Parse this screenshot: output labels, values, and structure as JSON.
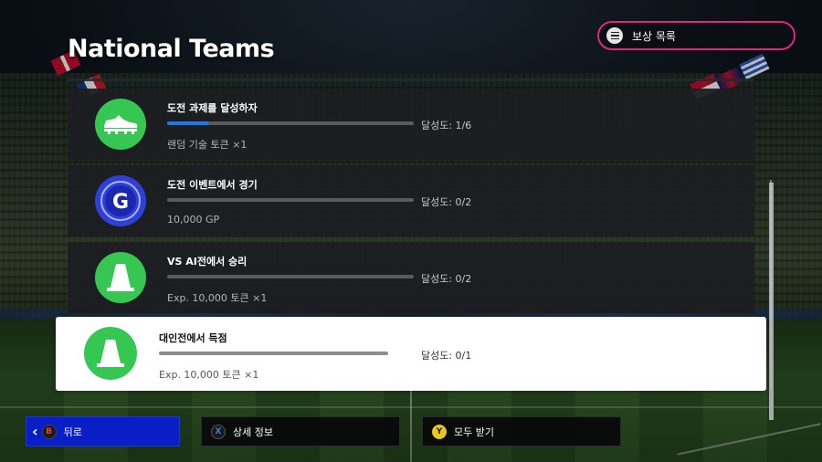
{
  "page": {
    "title": "National Teams"
  },
  "header": {
    "reward_list_label": "보상 목록",
    "reward_list_icon": "menu-icon"
  },
  "missions": [
    {
      "title": "도전 과제를 달성하자",
      "progress_text": "달성도: 1/6",
      "progress_fraction": 0.1667,
      "reward": "랜덤 기술 토큰 ×1",
      "icon": "boot-icon",
      "selected": false
    },
    {
      "title": "도전 이벤트에서 경기",
      "progress_text": "달성도: 0/2",
      "progress_fraction": 0,
      "reward": "10,000 GP",
      "icon": "gp-coin-icon",
      "selected": false
    },
    {
      "title": "VS AI전에서 승리",
      "progress_text": "달성도: 0/2",
      "progress_fraction": 0,
      "reward": "Exp. 10,000 토큰 ×1",
      "icon": "cone-icon",
      "selected": false
    },
    {
      "title": "대인전에서 득점",
      "progress_text": "달성도: 0/1",
      "progress_fraction": 0,
      "reward": "Exp. 10,000 토큰 ×1",
      "icon": "cone-icon",
      "selected": true
    }
  ],
  "footer": {
    "back": {
      "key": "B",
      "label": "뒤로"
    },
    "details": {
      "key": "X",
      "label": "상세 정보"
    },
    "claim_all": {
      "key": "Y",
      "label": "모두 받기"
    }
  },
  "colors": {
    "accent_pink": "#e1267f",
    "icon_green": "#35c752",
    "gp_blue": "#2f3fd8",
    "progress_blue": "#1e78e6",
    "back_button_blue": "#0a1ec8"
  }
}
